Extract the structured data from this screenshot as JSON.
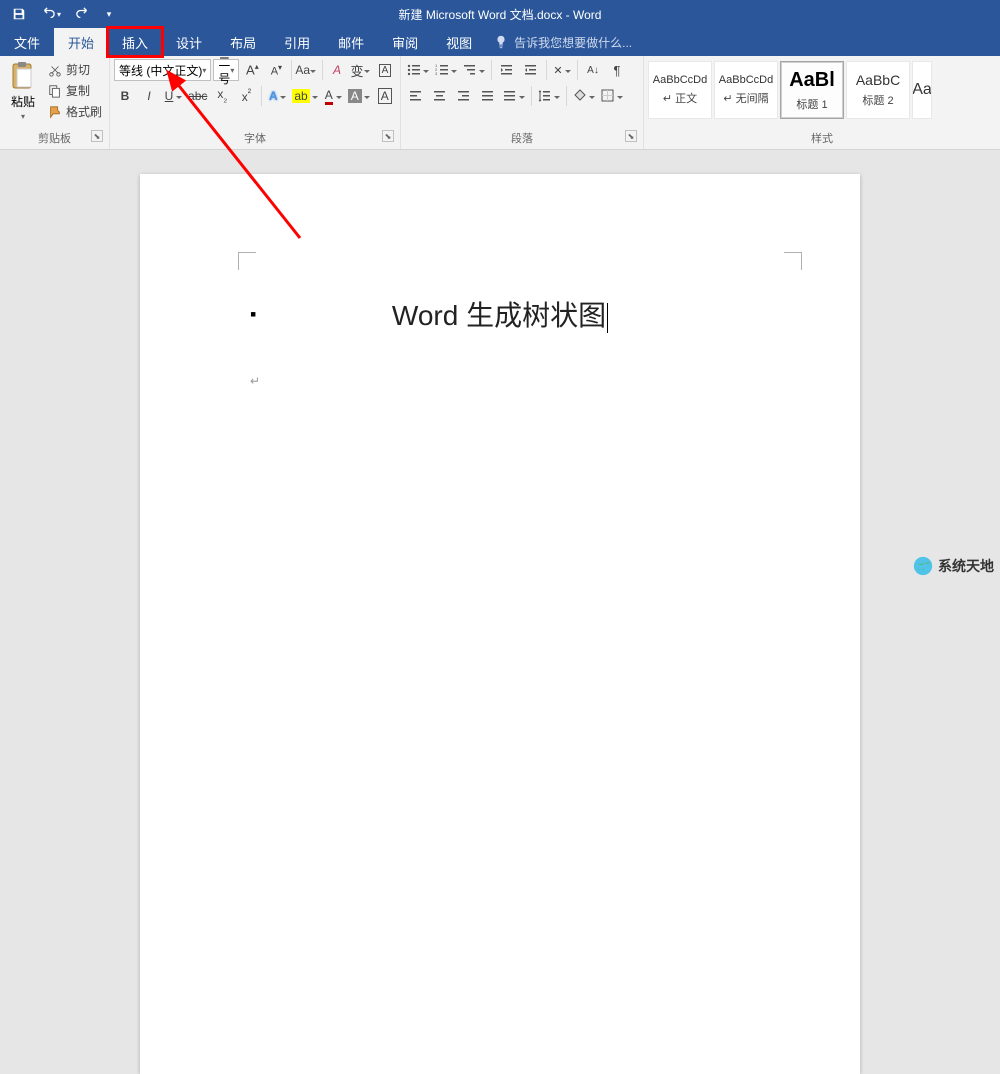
{
  "title": "新建 Microsoft Word 文档.docx - Word",
  "tabs": {
    "file": "文件",
    "home": "开始",
    "insert": "插入",
    "design": "设计",
    "layout": "布局",
    "references": "引用",
    "mailings": "邮件",
    "review": "审阅",
    "view": "视图",
    "tellme_placeholder": "告诉我您想要做什么..."
  },
  "clipboard": {
    "paste": "粘贴",
    "cut": "剪切",
    "copy": "复制",
    "format_painter": "格式刷",
    "group_label": "剪贴板"
  },
  "font": {
    "name": "等线 (中文正文)",
    "size": "二号",
    "bold": "B",
    "italic": "I",
    "underline": "U",
    "aa": "Aa",
    "wen": "wén",
    "group_label": "字体"
  },
  "paragraph": {
    "group_label": "段落"
  },
  "styles": {
    "items": [
      {
        "preview": "AaBbCcDd",
        "name": "↵ 正文"
      },
      {
        "preview": "AaBbCcDd",
        "name": "↵ 无间隔"
      },
      {
        "preview": "AaBl",
        "name": "标题 1"
      },
      {
        "preview": "AaBbC",
        "name": "标题 2"
      },
      {
        "preview": "Aa",
        "name": ""
      }
    ],
    "group_label": "样式"
  },
  "document": {
    "heading": "Word 生成树状图"
  },
  "watermark": "系统天地"
}
